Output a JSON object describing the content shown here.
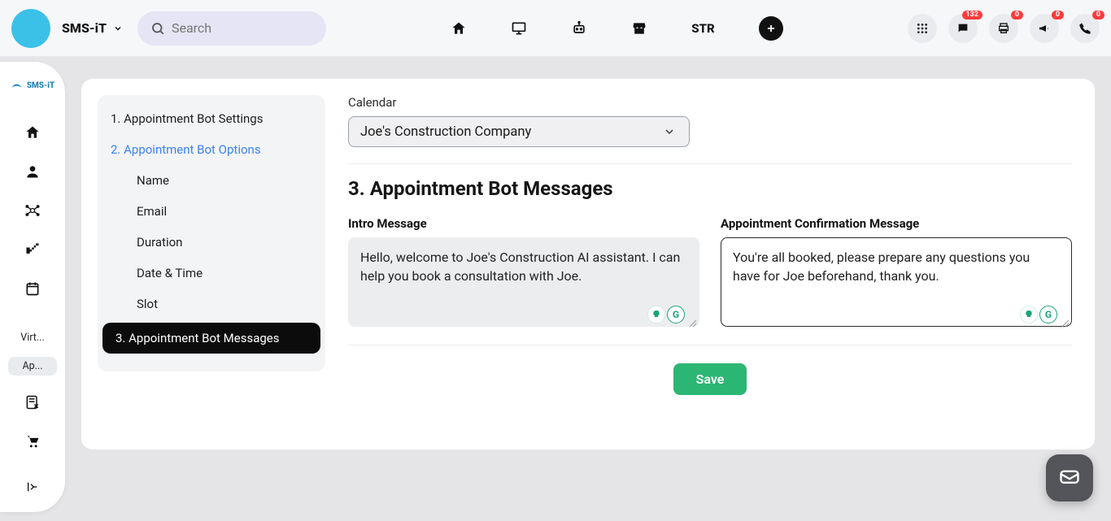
{
  "header": {
    "app_title": "SMS-iT",
    "search_placeholder": "Search",
    "center_str": "STR",
    "badges": {
      "chat": "132",
      "print": "0",
      "megaphone": "0",
      "phone": "0"
    }
  },
  "sidebar": {
    "logo_text": "SMS-iT",
    "labels": {
      "virt": "Virt...",
      "app": "Ap..."
    }
  },
  "settings_nav": {
    "item1": "1. Appointment Bot Settings",
    "item2": "2. Appointment Bot Options",
    "sub_name": "Name",
    "sub_email": "Email",
    "sub_duration": "Duration",
    "sub_datetime": "Date & Time",
    "sub_slot": "Slot",
    "item3": "3. Appointment Bot Messages"
  },
  "content": {
    "calendar_label": "Calendar",
    "calendar_value": "Joe's Construction Company",
    "section_title": "3. Appointment Bot Messages",
    "intro_label": "Intro Message",
    "intro_value": "Hello, welcome to Joe's Construction AI assistant. I can help you book a consultation with Joe.",
    "confirm_label": "Appointment Confirmation Message",
    "confirm_value": "You're all booked, please prepare any questions you have for Joe beforehand, thank you.",
    "save_label": "Save"
  }
}
